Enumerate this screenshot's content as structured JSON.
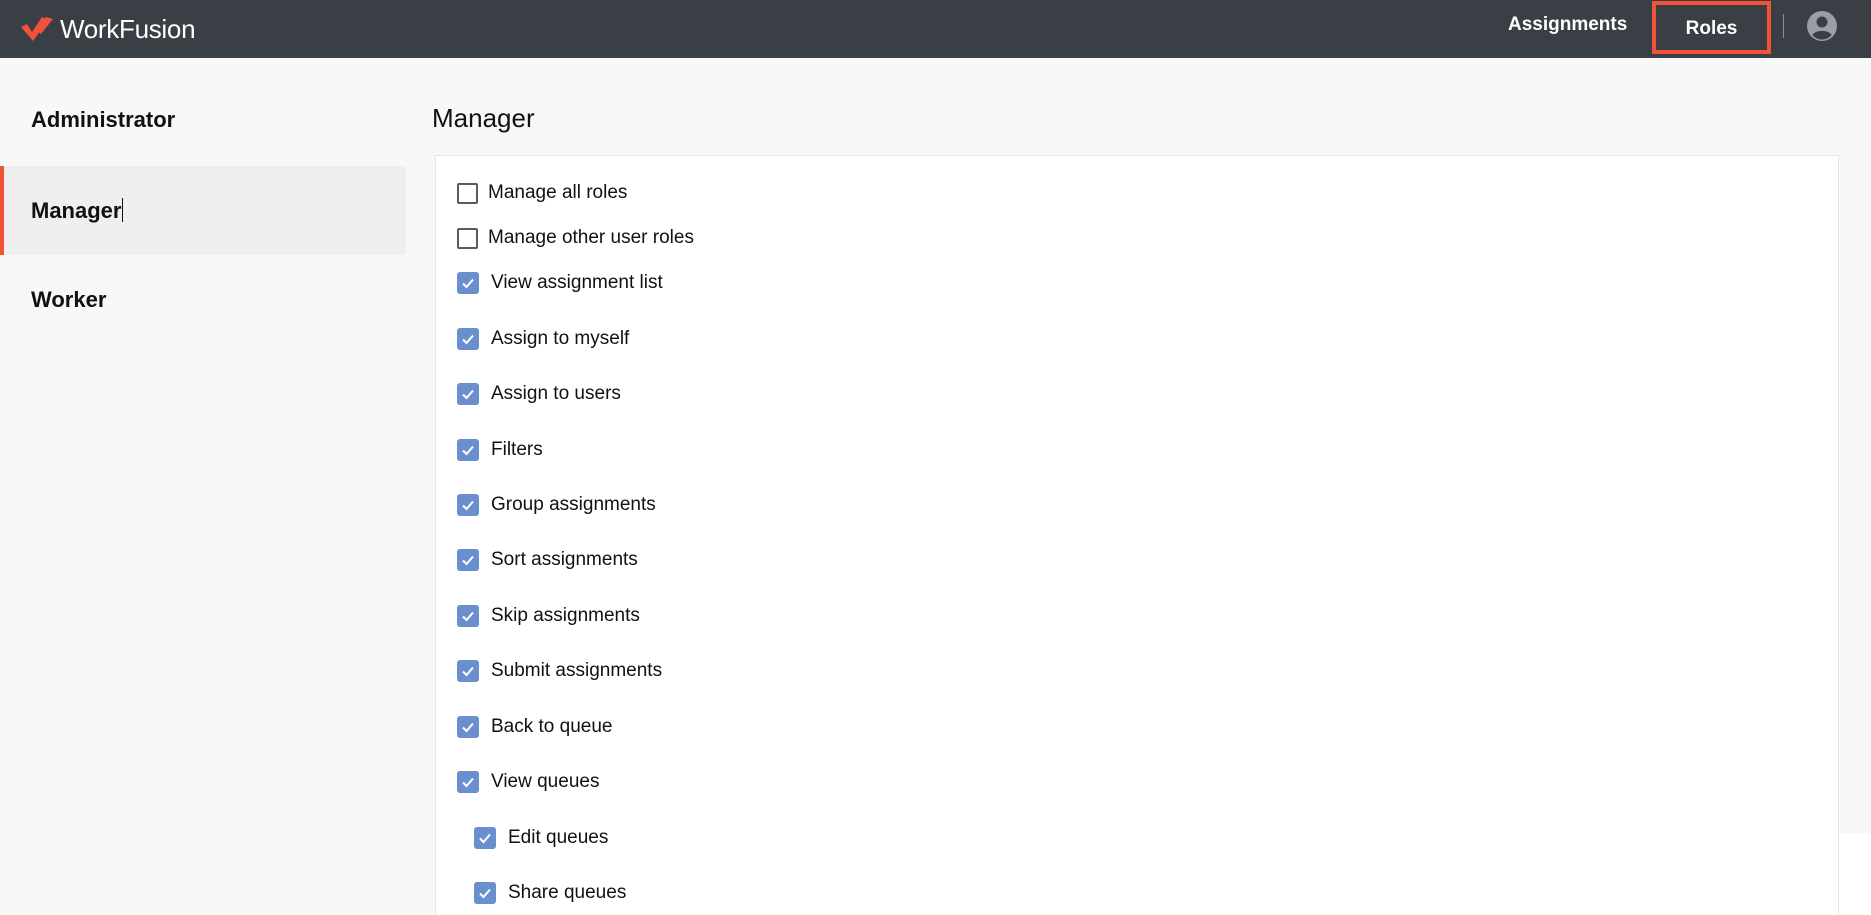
{
  "brand": {
    "name": "WorkFusion",
    "accent": "#f0523a"
  },
  "nav": {
    "assignments": "Assignments",
    "roles": "Roles",
    "avatar_icon": "account-circle-icon"
  },
  "sidebar": {
    "items": [
      {
        "label": "Administrator",
        "active": false
      },
      {
        "label": "Manager",
        "active": true
      },
      {
        "label": "Worker",
        "active": false
      }
    ]
  },
  "main": {
    "title": "Manager",
    "permissions": [
      {
        "label": "Manage all roles",
        "checked": false
      },
      {
        "label": "Manage other user roles",
        "checked": false
      },
      {
        "label": "View assignment list",
        "checked": true
      },
      {
        "label": "Assign to myself",
        "checked": true
      },
      {
        "label": "Assign to users",
        "checked": true
      },
      {
        "label": "Filters",
        "checked": true
      },
      {
        "label": "Group assignments",
        "checked": true
      },
      {
        "label": "Sort assignments",
        "checked": true
      },
      {
        "label": "Skip assignments",
        "checked": true
      },
      {
        "label": "Submit assignments",
        "checked": true
      },
      {
        "label": "Back to queue",
        "checked": true
      },
      {
        "label": "View queues",
        "checked": true
      },
      {
        "label": "Edit queues",
        "checked": true
      },
      {
        "label": "Share queues",
        "checked": true
      }
    ]
  },
  "colors": {
    "topbar": "#3a3e45",
    "checkbox": "#6a8fcf",
    "accent": "#f0523a"
  }
}
